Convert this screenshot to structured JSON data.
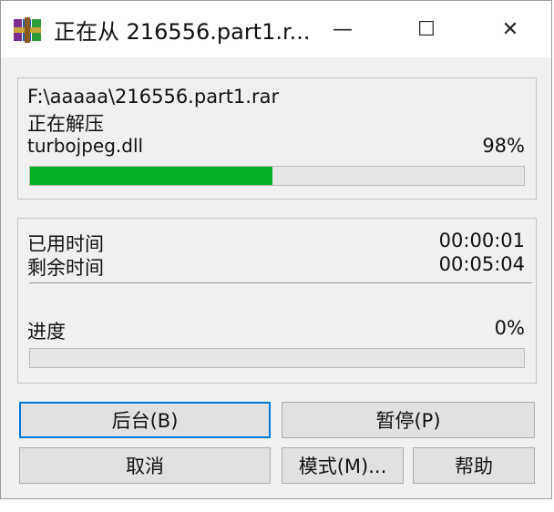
{
  "window": {
    "title": "正在从 216556.part1.r...",
    "minimize_glyph": "—",
    "maximize_glyph": "☐",
    "close_glyph": "✕"
  },
  "extract": {
    "path": "F:\\aaaaa\\216556.part1.rar",
    "action": "正在解压",
    "current_file": "turbojpeg.dll",
    "file_percent_label": "98%",
    "file_progress": 0.49
  },
  "timing": {
    "elapsed_label": "已用时间",
    "elapsed_value": "00:00:01",
    "remaining_label": "剩余时间",
    "remaining_value": "00:05:04",
    "progress_label": "进度",
    "progress_percent_label": "0%",
    "overall_progress": 0
  },
  "buttons": {
    "background": "后台(B)",
    "pause": "暂停(P)",
    "cancel": "取消",
    "mode": "模式(M)...",
    "help": "帮助"
  },
  "colors": {
    "progress_fill": "#06b025",
    "default_button_border": "#0078d7"
  }
}
